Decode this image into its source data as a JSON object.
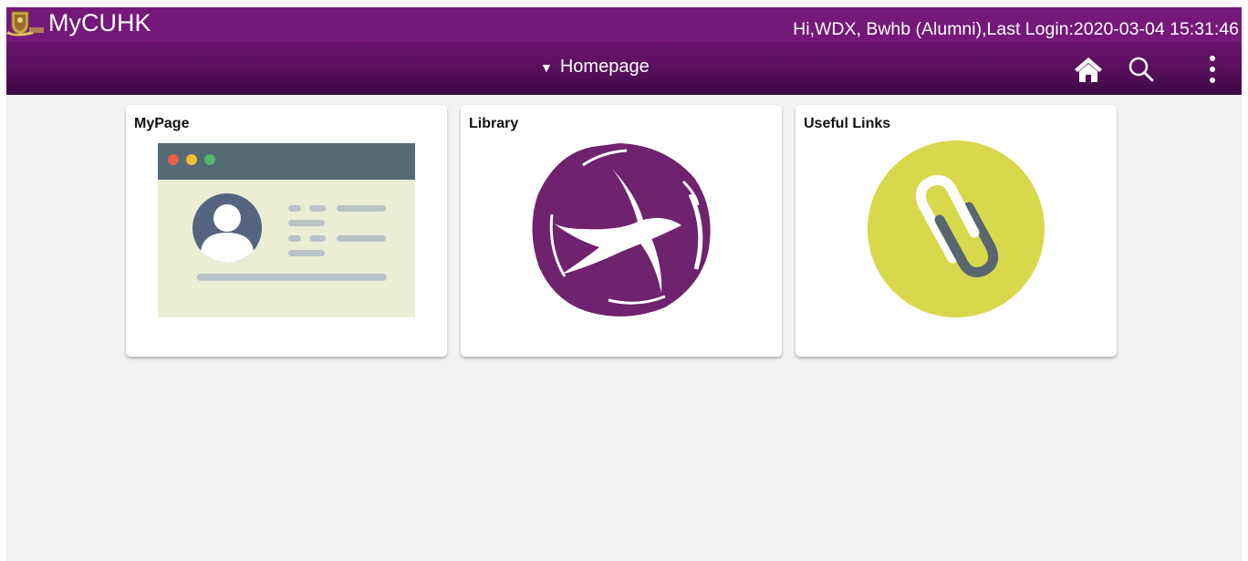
{
  "header": {
    "logo_text": "MyCUHK",
    "greeting": "Hi,WDX, Bwhb (Alumni),Last Login:2020-03-04 15:31:46",
    "nav_title": "Homepage",
    "nav_caret": "▼",
    "icons": [
      "home-icon",
      "search-icon",
      "more-vertical-icon"
    ]
  },
  "tiles": [
    {
      "title": "MyPage",
      "icon": "profile-card-illustration"
    },
    {
      "title": "Library",
      "icon": "library-swallow-logo"
    },
    {
      "title": "Useful Links",
      "icon": "link-chain-icon"
    }
  ],
  "colors": {
    "banner_purple": "#6c1470",
    "library_purple": "#6f226e",
    "links_yellow": "#d8d84c",
    "page_bg": "#f2f2f2"
  }
}
